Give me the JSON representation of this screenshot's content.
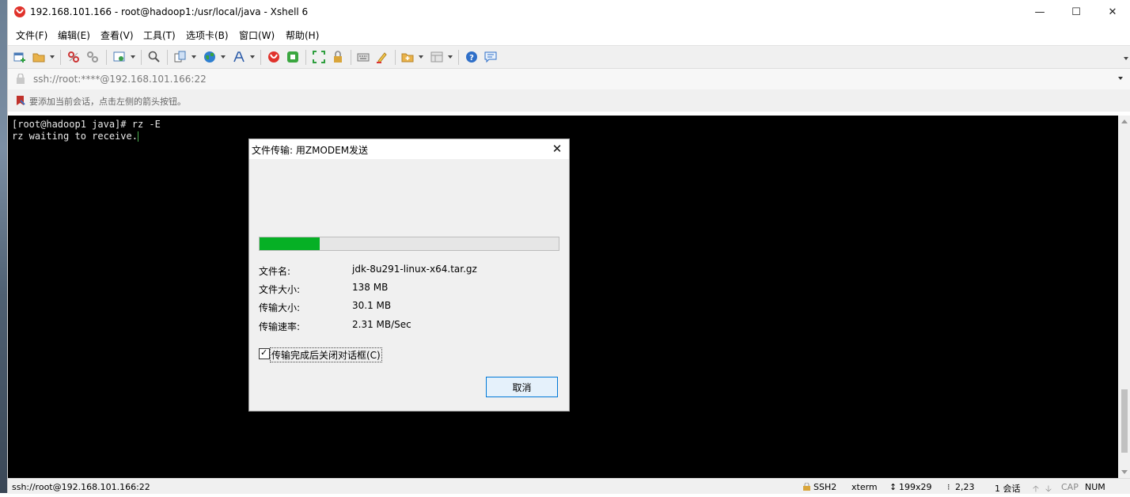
{
  "window": {
    "title": "192.168.101.166 - root@hadoop1:/usr/local/java - Xshell 6",
    "minimize_glyph": "—",
    "maximize_glyph": "☐",
    "close_glyph": "✕"
  },
  "menu": {
    "items": [
      "文件(F)",
      "编辑(E)",
      "查看(V)",
      "工具(T)",
      "选项卡(B)",
      "窗口(W)",
      "帮助(H)"
    ]
  },
  "toolbar": {
    "icons": [
      "new-session-icon",
      "open-folder-icon",
      "disconnect-icon",
      "reconnect-icon",
      "properties-icon",
      "find-icon",
      "copy-icon",
      "globe-icon",
      "font-icon",
      "xshell-icon",
      "xftp-icon",
      "fullscreen-icon",
      "lock-icon",
      "keyboard-icon",
      "highlight-icon",
      "new-tab-icon",
      "layout-icon",
      "help-icon",
      "chat-icon"
    ]
  },
  "address": {
    "text": "ssh://root:****@192.168.101.166:22"
  },
  "tip": {
    "text": "要添加当前会话，点击左侧的箭头按钮。"
  },
  "terminal": {
    "lines": [
      "[root@hadoop1 java]# rz -E",
      "rz waiting to receive."
    ]
  },
  "dialog": {
    "title": "文件传输: 用ZMODEM发送",
    "close_glyph": "✕",
    "progress": 0.2,
    "progress_color": "#06b025",
    "rows": [
      {
        "label": "文件名:",
        "value": "jdk-8u291-linux-x64.tar.gz"
      },
      {
        "label": "文件大小:",
        "value": "138 MB"
      },
      {
        "label": "传输大小:",
        "value": "30.1 MB"
      },
      {
        "label": "传输速率:",
        "value": "2.31 MB/Sec"
      }
    ],
    "checkbox_label": "传输完成后关闭对话框(C)",
    "checkbox_checked": true,
    "checkbox_glyph": "✓",
    "cancel_label": "取消"
  },
  "status": {
    "connection": "ssh://root@192.168.101.166:22",
    "protocol": "SSH2",
    "terminal_type": "xterm",
    "size": "199x29",
    "cursor_pos": "2,23",
    "sessions": "1 会话",
    "caps": "CAP",
    "num": "NUM"
  }
}
